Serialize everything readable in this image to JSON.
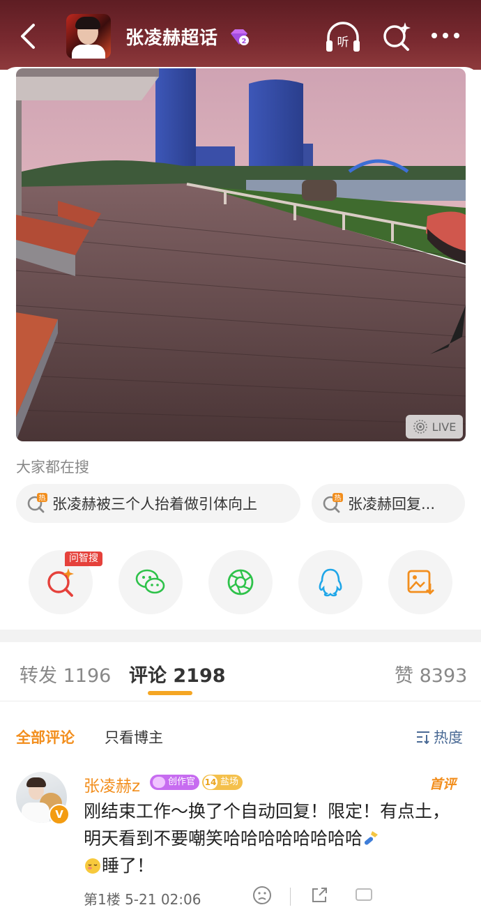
{
  "header": {
    "title": "张凌赫超话",
    "badge_level": "2",
    "listen_label": "听"
  },
  "post": {
    "live_label": "LIVE"
  },
  "hot_search": {
    "label": "大家都在搜",
    "chips": [
      {
        "text": "张凌赫被三个人抬着做引体向上",
        "tag": "热"
      },
      {
        "text": "张凌赫回复...",
        "tag": "热"
      }
    ]
  },
  "share": {
    "ai_tag": "问智搜",
    "buttons": [
      "ai-search",
      "wechat",
      "moments",
      "qq",
      "save-image"
    ]
  },
  "stats": {
    "repost": "转发 1196",
    "comments": "评论 2198",
    "likes": "赞 8393"
  },
  "filter": {
    "all": "全部评论",
    "host_only": "只看博主",
    "sort": "热度"
  },
  "comment": {
    "user": "张凌赫z",
    "creator_tag": "创作官",
    "level": "14",
    "level_tag": "盐场",
    "first_tag": "首评",
    "text_part1": "刚结束工作～换了个自动回复！限定！有点土，明天看到不要嘲笑哈哈哈哈哈哈哈哈",
    "text_part2": "睡了！",
    "floor_time": "第1楼 5-21 02:06"
  },
  "colors": {
    "header_bg": "#6b2328",
    "accent": "#f28e1d",
    "link_blue": "#4a6a95"
  }
}
